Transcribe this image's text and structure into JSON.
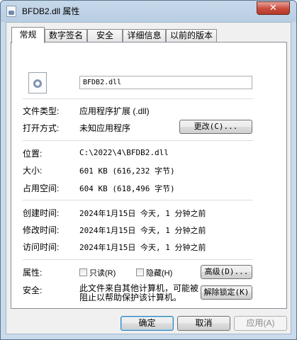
{
  "window": {
    "title": "BFDB2.dll 属性",
    "close_label": "✕"
  },
  "tabs": [
    {
      "label": "常规"
    },
    {
      "label": "数字签名"
    },
    {
      "label": "安全"
    },
    {
      "label": "详细信息"
    },
    {
      "label": "以前的版本"
    }
  ],
  "general": {
    "file_name": "BFDB2.dll",
    "file_type_label": "文件类型:",
    "file_type_value": "应用程序扩展 (.dll)",
    "open_with_label": "打开方式:",
    "open_with_value": "未知应用程序",
    "change_button": "更改(C)...",
    "location_label": "位置:",
    "location_value": "C:\\2022\\4\\BFDB2.dll",
    "size_label": "大小:",
    "size_value": "601 KB (616,232 字节)",
    "size_on_disk_label": "占用空间:",
    "size_on_disk_value": "604 KB (618,496 字节)",
    "created_label": "创建时间:",
    "created_value": "2024年1月15日 今天, 1 分钟之前",
    "modified_label": "修改时间:",
    "modified_value": "2024年1月15日 今天, 1 分钟之前",
    "accessed_label": "访问时间:",
    "accessed_value": "2024年1月15日 今天, 1 分钟之前",
    "attributes_label": "属性:",
    "readonly_label": "只读(R)",
    "hidden_label": "隐藏(H)",
    "advanced_button": "高级(D)...",
    "security_label": "安全:",
    "security_text": "此文件来自其他计算机，可能被阻止以帮助保护该计算机。",
    "unblock_button": "解除锁定(K)"
  },
  "footer": {
    "ok_button": "确定",
    "cancel_button": "取消",
    "apply_button": "应用(A)"
  }
}
